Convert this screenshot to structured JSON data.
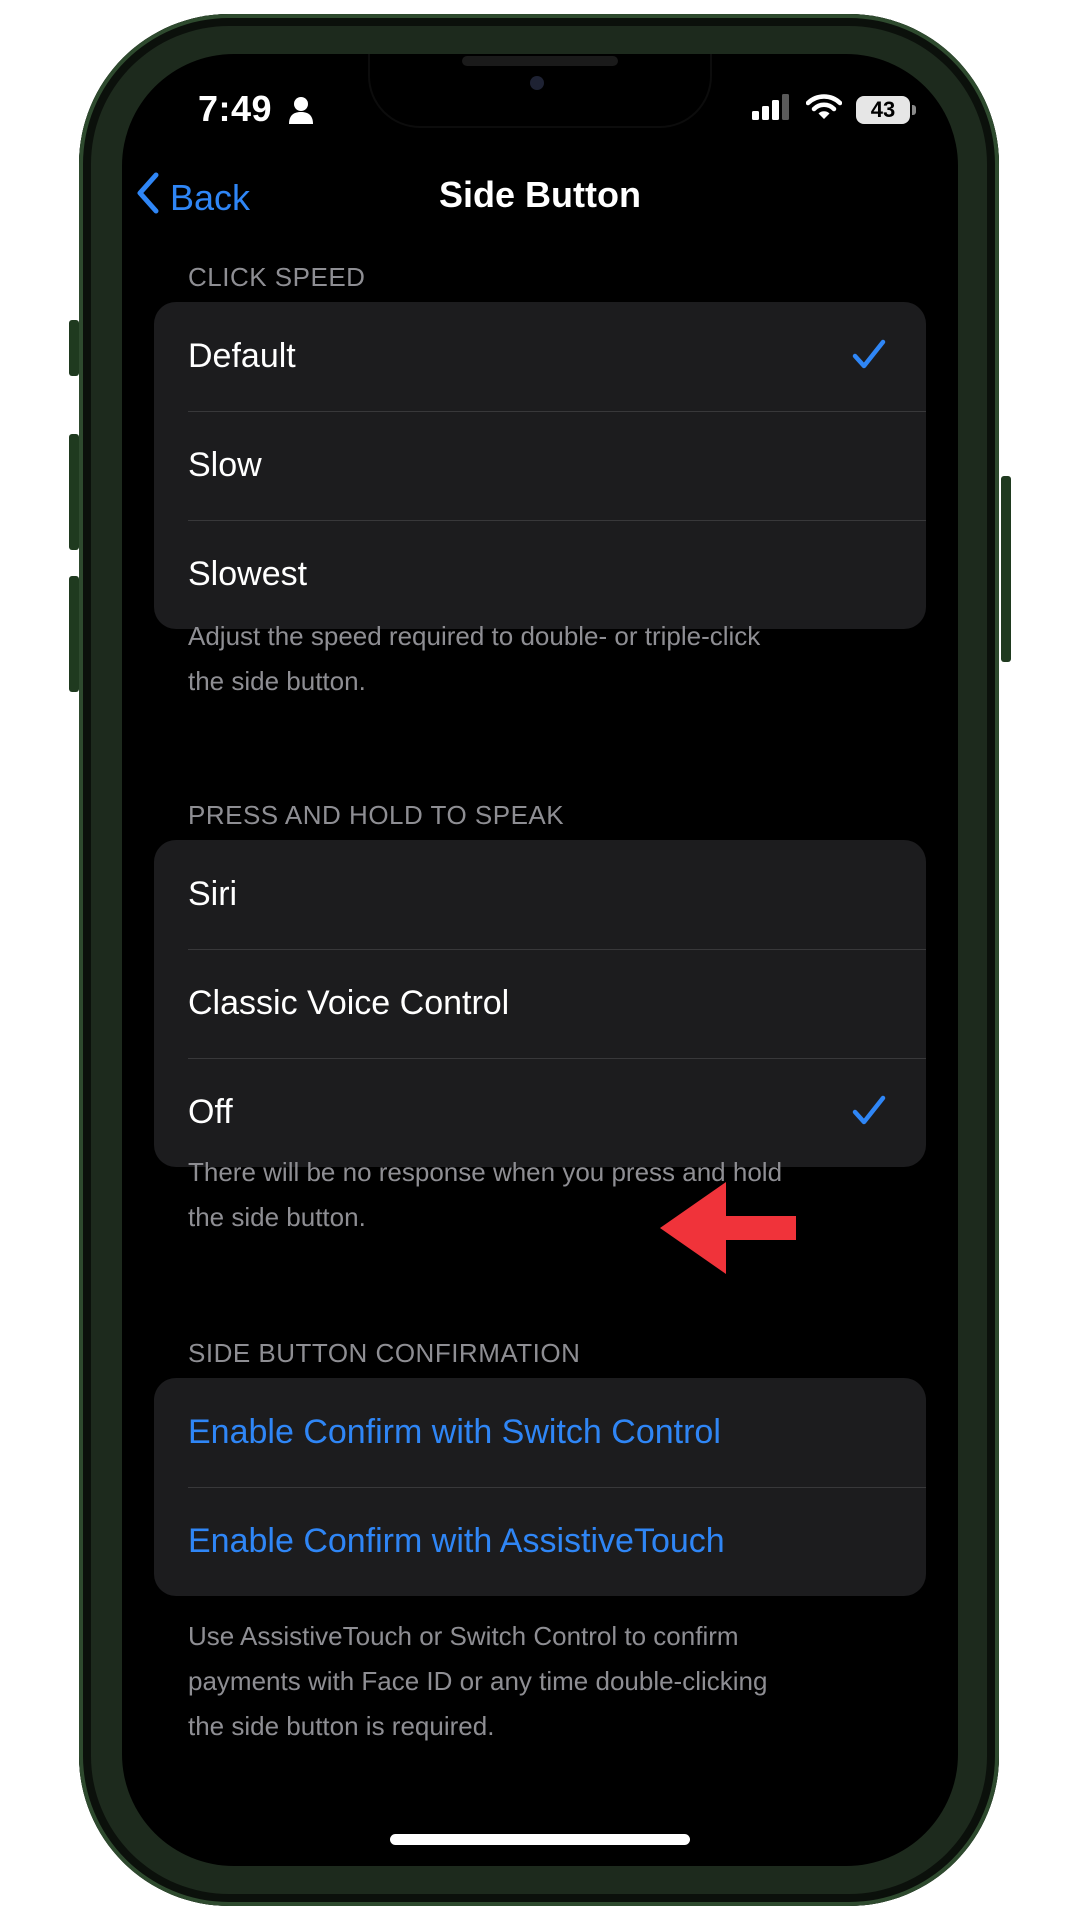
{
  "status_bar": {
    "time": "7:49",
    "battery": "43"
  },
  "nav": {
    "back_label": "Back",
    "title": "Side Button"
  },
  "click_speed": {
    "header": "CLICK SPEED",
    "options": [
      "Default",
      "Slow",
      "Slowest"
    ],
    "selected": "Default",
    "footer_line1": "Adjust the speed required to double- or triple-click",
    "footer_line2": "the side button."
  },
  "press_and_hold": {
    "header": "PRESS AND HOLD TO SPEAK",
    "options": [
      "Siri",
      "Classic Voice Control",
      "Off"
    ],
    "selected": "Off",
    "footer_line1": "There will be no response when you press and hold",
    "footer_line2": "the side button."
  },
  "confirmation": {
    "header": "SIDE BUTTON CONFIRMATION",
    "links": [
      "Enable Confirm with Switch Control",
      "Enable Confirm with AssistiveTouch"
    ],
    "footer_line1": "Use AssistiveTouch or Switch Control to confirm",
    "footer_line2": "payments with Face ID or any time double-clicking",
    "footer_line3": "the side button is required."
  },
  "colors": {
    "accent": "#2f86f6",
    "annotation_arrow": "#f0333a",
    "phone_frame": "#1d2a1d"
  }
}
